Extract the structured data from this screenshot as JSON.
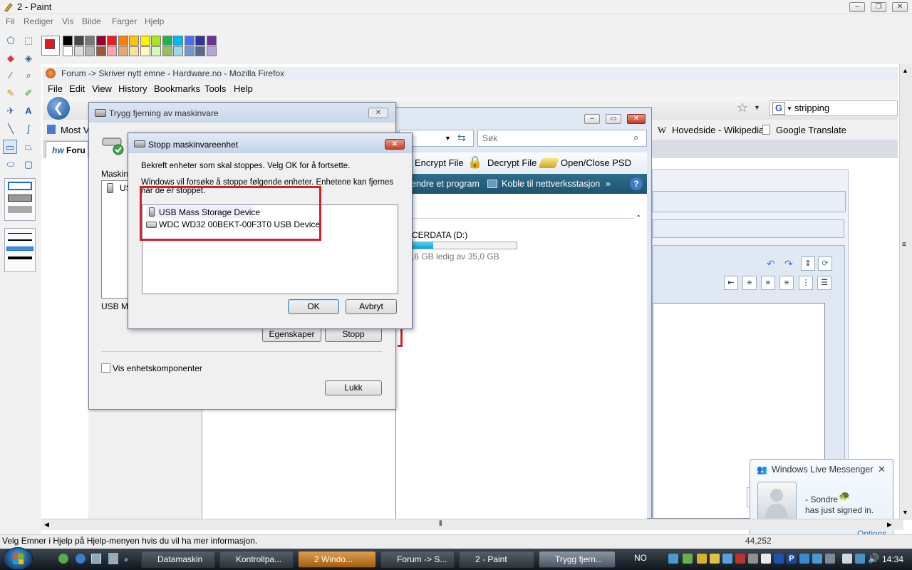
{
  "paint": {
    "title": "2 - Paint",
    "menu": [
      "Fil",
      "Rediger",
      "Vis",
      "Bilde",
      "Farger",
      "Hjelp"
    ],
    "status_text": "Velg Emner i Hjelp på Hjelp-menyen hvis du vil ha mer informasjon.",
    "status_coords": "44,252",
    "colors": {
      "primary": "#e41b1b",
      "palette_top": [
        "#000000",
        "#464646",
        "#787878",
        "#990030",
        "#ed1c24",
        "#ff7e00",
        "#ffc20e",
        "#fff200",
        "#a8e61d",
        "#22b14c",
        "#00b7ef",
        "#4d6df3",
        "#2f3699",
        "#6f3198"
      ],
      "palette_bottom": [
        "#ffffff",
        "#dcdcdc",
        "#b4b4b4",
        "#9c5a3c",
        "#ffa3b1",
        "#e5aa7a",
        "#f5e49c",
        "#fff9bd",
        "#d3f9bc",
        "#9dbb61",
        "#99d9ea",
        "#709ad1",
        "#546d8e",
        "#b5a5d5"
      ]
    }
  },
  "firefox": {
    "title": "Forum -> Skriver nytt emne - Hardware.no - Mozilla Firefox",
    "menu": [
      "File",
      "Edit",
      "View",
      "History",
      "Bookmarks",
      "Tools",
      "Help"
    ],
    "search_value": "stripping",
    "bookmarks": [
      "Most V",
      "Hovedside - Wikipedia",
      "Google Translate"
    ],
    "tab_label": "Foru"
  },
  "explorer": {
    "search_placeholder": "Søk",
    "toolbar1": [
      "Encrypt File",
      "Decrypt File",
      "Open/Close PSD"
    ],
    "toolbar2": [
      "endre et program",
      "Koble til nettverksstasjon",
      "»"
    ],
    "drive_label": "CERDATA (D:)",
    "drive_free": ",6 GB ledig av 35,0 GB",
    "drive_used_fraction": 0.2
  },
  "trygg": {
    "title": "Trygg fjerning av maskinvare",
    "label_maskin": "Maskinv",
    "list_item": "US",
    "label_usb": "USB Ma",
    "btn_properties": "Egenskaper",
    "btn_stop": "Stopp",
    "checkbox_label": "Vis enhetskomponenter",
    "btn_close": "Lukk"
  },
  "stopp": {
    "title": "Stopp maskinvareenhet",
    "line1": "Bekreft enheter som skal stoppes. Velg OK for å fortsette.",
    "line2": "Windows vil forsøke å stoppe følgende enheter. Enhetene kan fjernes når de er stoppet.",
    "devices": [
      "USB Mass Storage Device",
      "WDC WD32 00BEKT-00F3T0 USB Device"
    ],
    "btn_ok": "OK",
    "btn_cancel": "Avbryt"
  },
  "messenger": {
    "title": "Windows Live Messenger",
    "name": "- Sondre",
    "message": "has just signed in.",
    "options": "Options"
  },
  "taskbar": {
    "tasks": [
      "Datamaskin",
      "Kontrollpa...",
      "2 Windo...",
      "Forum -> S...",
      "2 - Paint",
      "Trygg fjern..."
    ],
    "lang": "NO",
    "time": "14:34"
  }
}
